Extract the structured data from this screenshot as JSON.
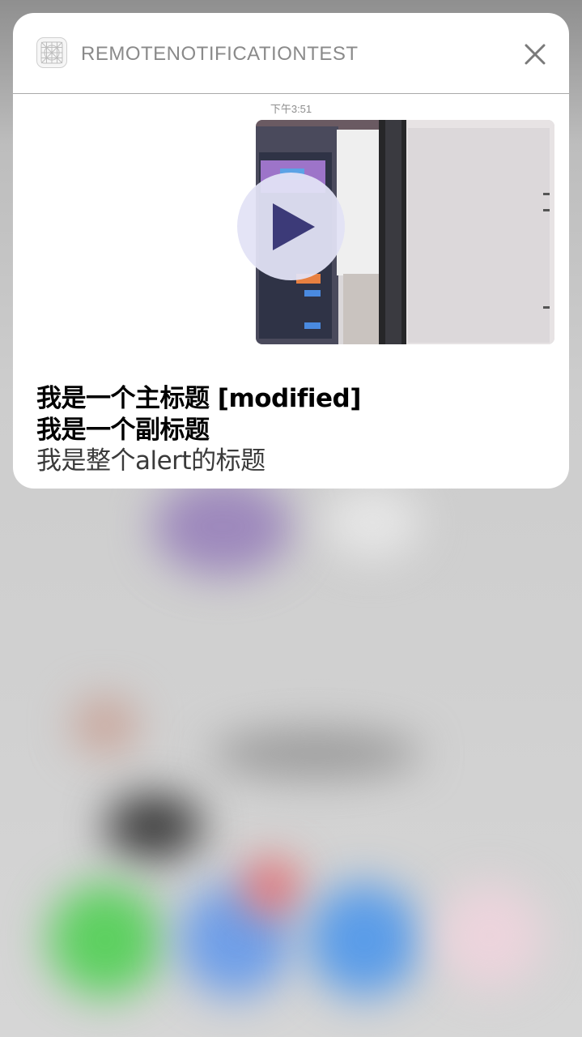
{
  "notification": {
    "app_name": "REMOTENOTIFICATIONTEST",
    "app_icon": "app-grid-icon",
    "close_icon": "close-icon",
    "timestamp": "下午3:51",
    "media": {
      "type": "video",
      "play_icon": "play-icon"
    },
    "title": "我是一个主标题 [modified]",
    "subtitle": "我是一个副标题",
    "body": "我是整个alert的标题"
  },
  "colors": {
    "card_background": "#ffffff",
    "app_name": "#8a8a8a",
    "play_button_fill": "#e2e2f5",
    "play_triangle": "#3c3a78"
  }
}
